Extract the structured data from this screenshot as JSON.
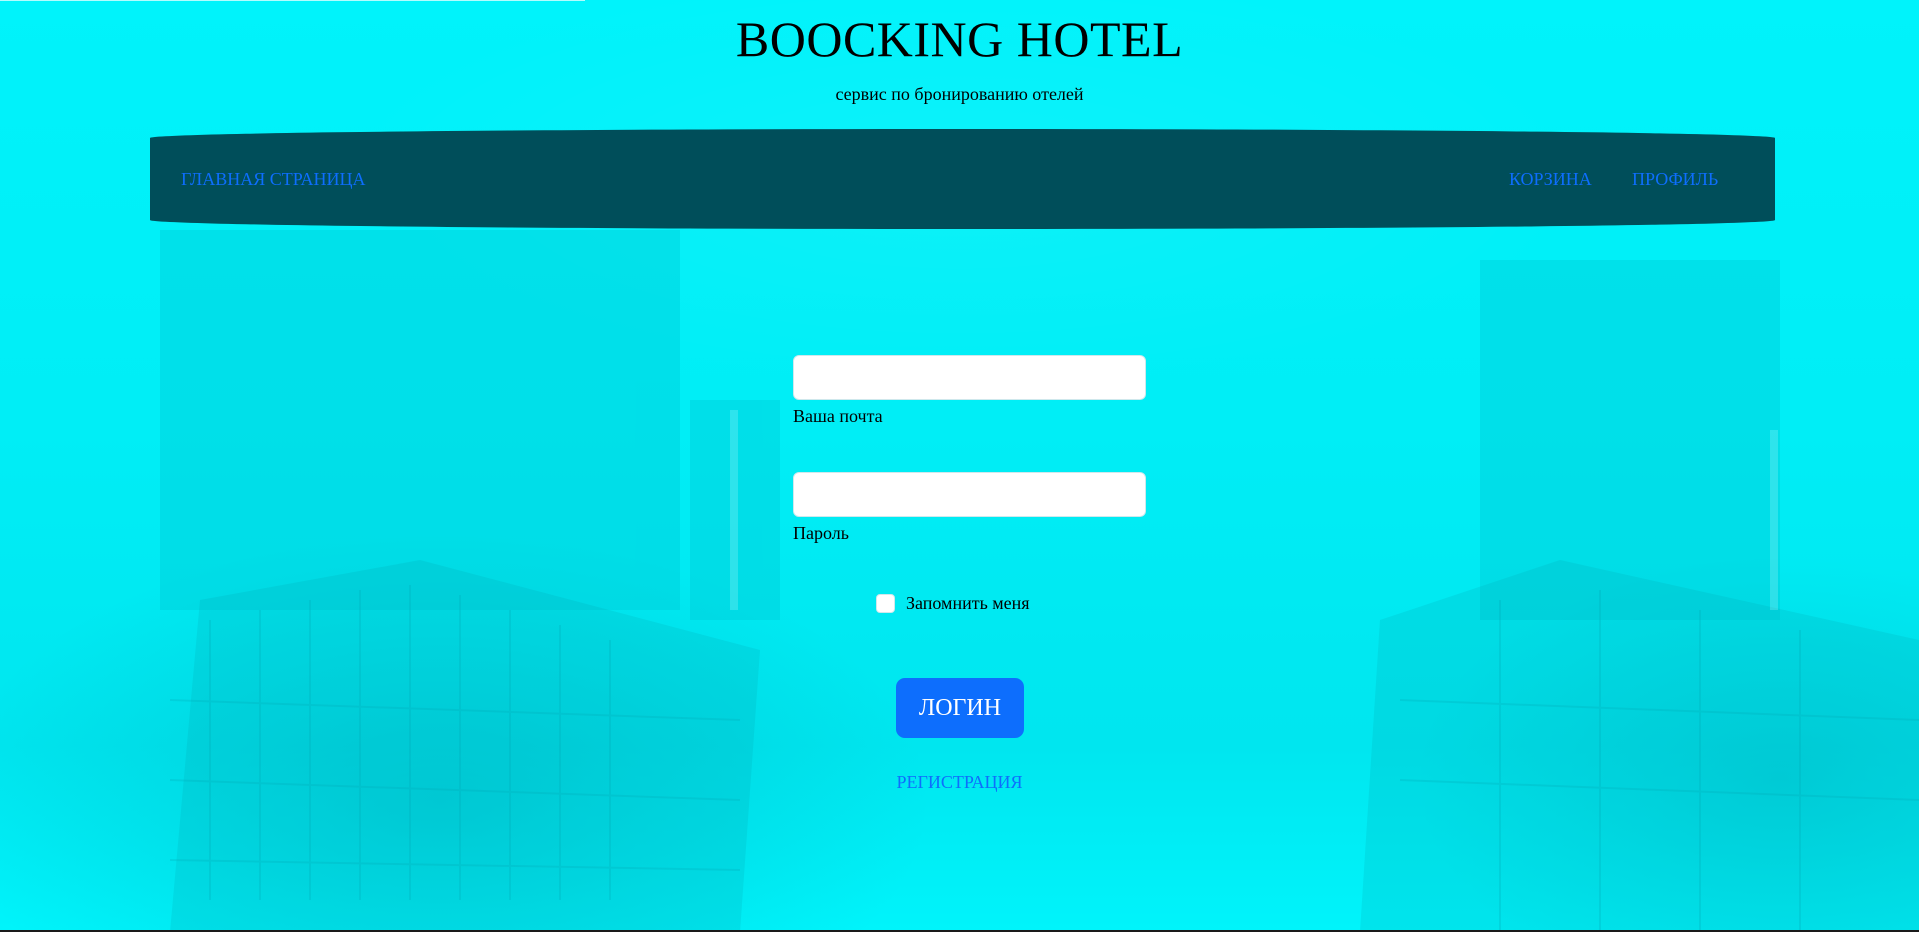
{
  "header": {
    "title": "BOOCKING HOTEL",
    "subtitle": "сервис по бронированию отелей"
  },
  "nav": {
    "home": "ГЛАВНАЯ СТРАНИЦА",
    "cart": "КОРЗИНА",
    "profile": "ПРОФИЛЬ"
  },
  "login_form": {
    "email_value": "",
    "email_label": "Ваша почта",
    "password_value": "",
    "password_label": "Пароль",
    "remember_label": "Запомнить меня",
    "remember_checked": false,
    "login_button": "ЛОГИН",
    "register_link": "РЕГИСТРАЦИЯ"
  },
  "colors": {
    "background": "#00f4fb",
    "navbar": "#004e5a",
    "link": "#0d6efd",
    "button": "#0d6efd"
  }
}
